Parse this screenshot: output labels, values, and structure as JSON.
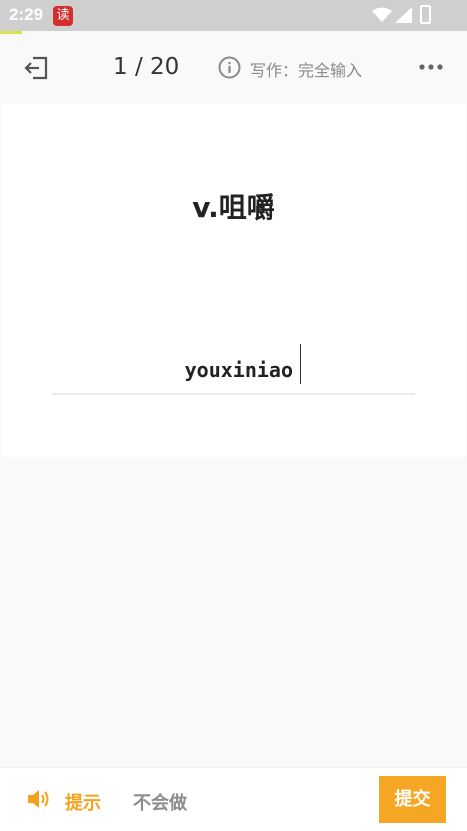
{
  "status_bar": {
    "time": "2:29",
    "app_icon_glyph": "读",
    "icons": [
      "wifi-icon",
      "signal-icon",
      "battery-icon"
    ]
  },
  "toolbar": {
    "counter": "1 / 20",
    "mode_label": "写作：完全输入",
    "icons": [
      "exit-icon",
      "info-icon",
      "more-icon"
    ]
  },
  "card": {
    "word": "v.咀嚼",
    "answer_value": "youxiniao"
  },
  "bottom_bar": {
    "hint_label": "提示",
    "dont_know_label": "不会做",
    "submit_label": "提交"
  },
  "colors": {
    "accent": "#f5a623",
    "hint_text": "#f5a11c",
    "muted_text": "#8d8d8d"
  }
}
